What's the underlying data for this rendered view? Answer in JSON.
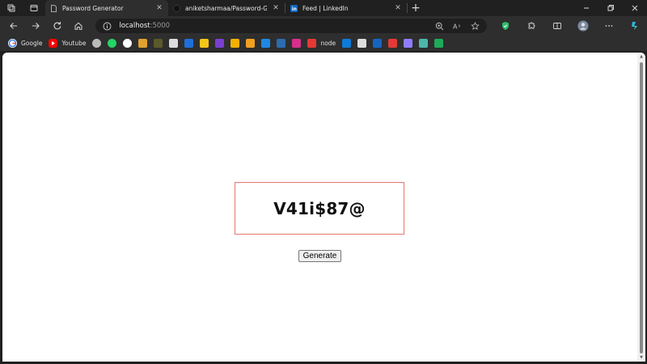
{
  "tabs": [
    {
      "title": "Password Generator",
      "active": true
    },
    {
      "title": "aniketsharmaa/Password-Genera",
      "active": false
    },
    {
      "title": "Feed | LinkedIn",
      "active": false
    }
  ],
  "address": {
    "host": "localhost",
    "port": ":5000"
  },
  "bookmarks": [
    {
      "label": "Google",
      "icon": "google-icon",
      "color": "#ffffff"
    },
    {
      "label": "Youtube",
      "icon": "youtube-icon",
      "color": "#ff0000"
    },
    {
      "label": "",
      "icon": "globe-icon",
      "color": "#bbbbbb"
    },
    {
      "label": "",
      "icon": "whatsapp-icon",
      "color": "#25d366"
    },
    {
      "label": "",
      "icon": "github-icon",
      "color": "#ffffff"
    },
    {
      "label": "",
      "icon": "bookmark-icon",
      "color": "#e0a030"
    },
    {
      "label": "",
      "icon": "bookmark-icon",
      "color": "#5a5a2a"
    },
    {
      "label": "",
      "icon": "monitor-icon",
      "color": "#dddddd"
    },
    {
      "label": "",
      "icon": "bookmark-icon",
      "color": "#1e6fd9"
    },
    {
      "label": "",
      "icon": "bookmark-icon",
      "color": "#f5c518"
    },
    {
      "label": "",
      "icon": "bolt-icon",
      "color": "#7b3fd1"
    },
    {
      "label": "",
      "icon": "info-icon",
      "color": "#f2b100"
    },
    {
      "label": "",
      "icon": "bookmark-icon",
      "color": "#f0a020"
    },
    {
      "label": "",
      "icon": "bookmark-icon",
      "color": "#1e88e5"
    },
    {
      "label": "",
      "icon": "bookmark-icon",
      "color": "#2b6cb0"
    },
    {
      "label": "",
      "icon": "bookmark-icon",
      "color": "#d6308c"
    },
    {
      "label": "node",
      "icon": "bookmark-icon",
      "color": "#e53935"
    },
    {
      "label": "",
      "icon": "bookmark-icon",
      "color": "#0f7bd8"
    },
    {
      "label": "",
      "icon": "file-icon",
      "color": "#dddddd"
    },
    {
      "label": "",
      "icon": "bookmark-icon",
      "color": "#1565c0"
    },
    {
      "label": "",
      "icon": "bookmark-icon",
      "color": "#e53935"
    },
    {
      "label": "",
      "icon": "sparkle-icon",
      "color": "#8e7cff"
    },
    {
      "label": "",
      "icon": "bookmark-icon",
      "color": "#4db6ac"
    },
    {
      "label": "",
      "icon": "bookmark-icon",
      "color": "#1faa59"
    }
  ],
  "page": {
    "password": "V41i$87@",
    "generate_label": "Generate"
  }
}
